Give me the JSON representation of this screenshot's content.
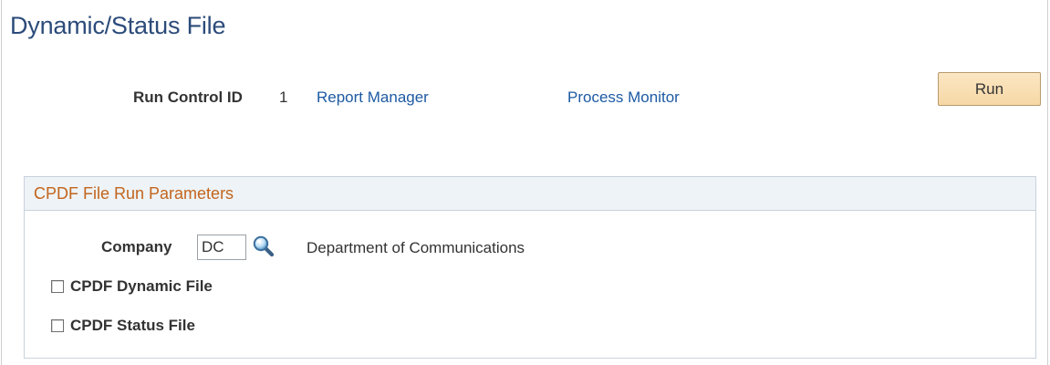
{
  "page": {
    "title": "Dynamic/Status File"
  },
  "run_control": {
    "label": "Run Control ID",
    "value": "1"
  },
  "links": {
    "report_manager": "Report Manager",
    "process_monitor": "Process Monitor"
  },
  "toolbar": {
    "run_label": "Run"
  },
  "parameters": {
    "title": "CPDF File Run Parameters",
    "company_label": "Company",
    "company_value": "DC",
    "company_description": "Department of Communications",
    "lookup_icon": "magnifier-lookup-icon",
    "checkboxes": [
      {
        "label": "CPDF Dynamic File",
        "checked": false
      },
      {
        "label": "CPDF Status File",
        "checked": false
      }
    ]
  },
  "colors": {
    "title": "#2c4b7a",
    "link": "#1d5aa3",
    "group_title": "#c3651d",
    "group_header_bg": "#eef3f7",
    "button_bg": "#f6d8a5"
  }
}
